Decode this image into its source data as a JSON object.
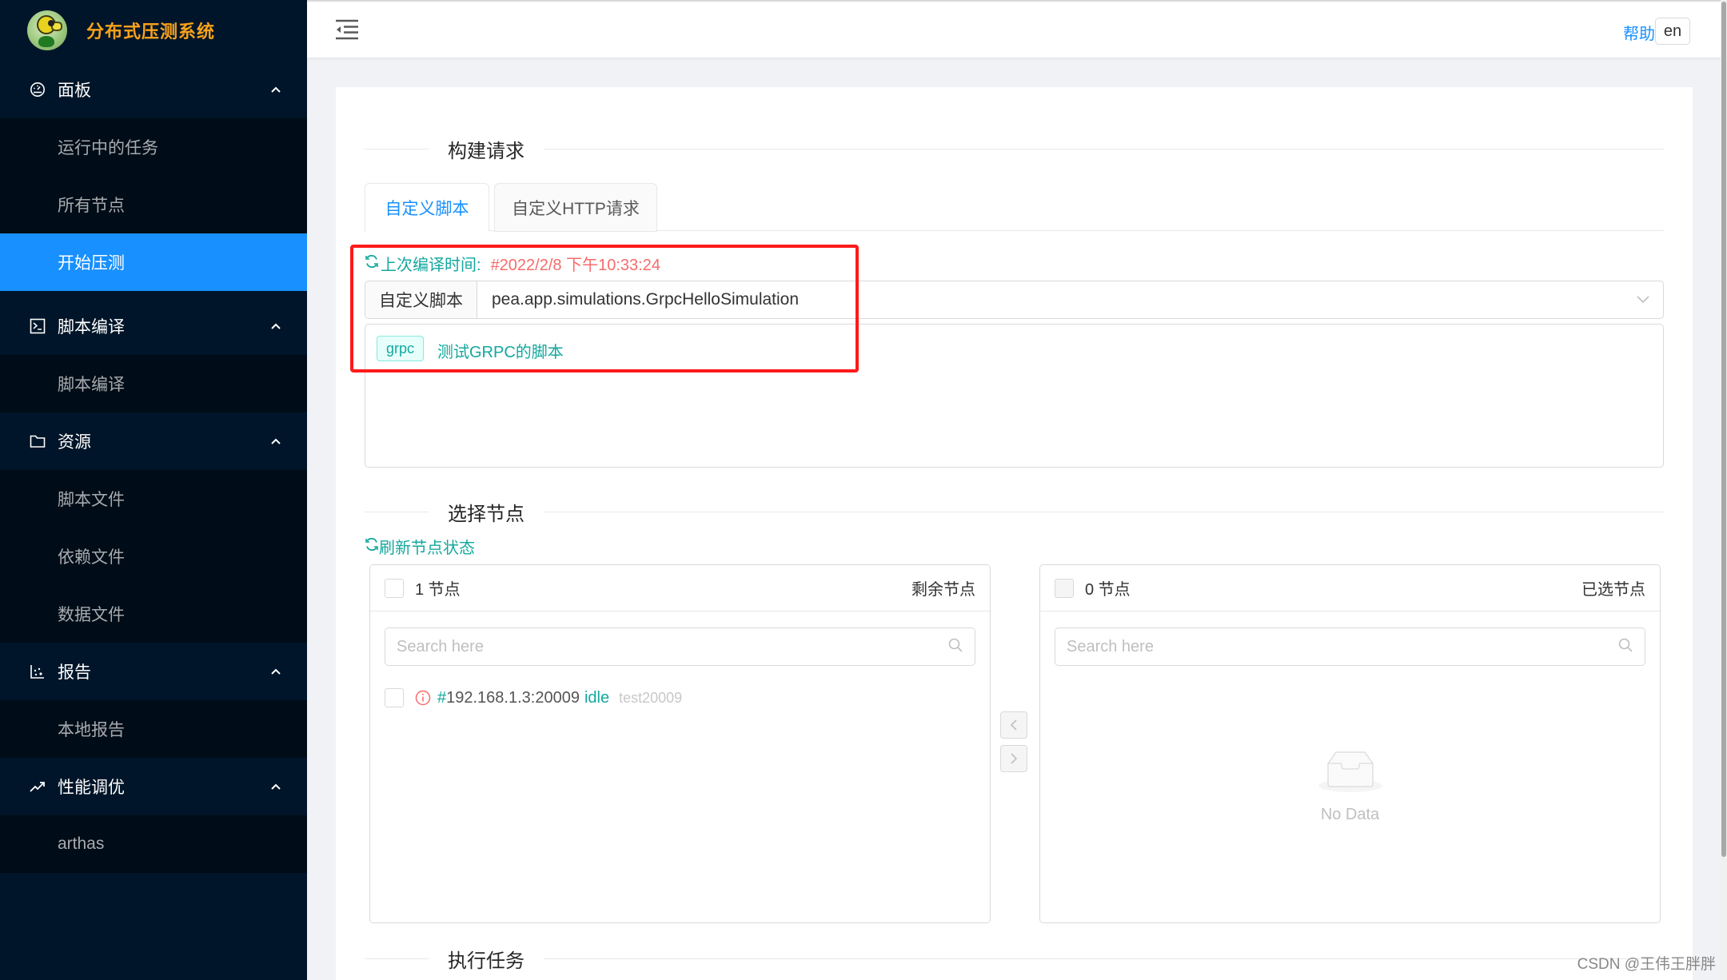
{
  "app": {
    "title": "分布式压测系统"
  },
  "sidebar": {
    "groups": [
      {
        "label": "面板",
        "icon": "dashboard-icon",
        "items": [
          {
            "label": "运行中的任务"
          },
          {
            "label": "所有节点"
          },
          {
            "label": "开始压测",
            "active": true
          }
        ]
      },
      {
        "label": "脚本编译",
        "icon": "terminal-icon",
        "items": [
          {
            "label": "脚本编译"
          }
        ]
      },
      {
        "label": "资源",
        "icon": "folder-icon",
        "items": [
          {
            "label": "脚本文件"
          },
          {
            "label": "依赖文件"
          },
          {
            "label": "数据文件"
          }
        ]
      },
      {
        "label": "报告",
        "icon": "dot-chart-icon",
        "items": [
          {
            "label": "本地报告"
          }
        ]
      },
      {
        "label": "性能调优",
        "icon": "rise-icon",
        "items": [
          {
            "label": "arthas"
          }
        ]
      }
    ]
  },
  "header": {
    "help_label": "帮助",
    "lang_label": "en"
  },
  "main": {
    "section_build": "构建请求",
    "tabs": [
      {
        "label": "自定义脚本",
        "active": true
      },
      {
        "label": "自定义HTTP请求",
        "active": false
      }
    ],
    "compile": {
      "label": "上次编译时间:",
      "time": "#2022/2/8 下午10:33:24"
    },
    "script_select": {
      "addon_label": "自定义脚本",
      "value": "pea.app.simulations.GrpcHelloSimulation"
    },
    "script_desc": {
      "tag": "grpc",
      "text": "测试GRPC的脚本"
    },
    "section_nodes": "选择节点",
    "refresh_label": "刷新节点状态",
    "transfer": {
      "left": {
        "count_label": "1 节点",
        "title": "剩余节点",
        "search_placeholder": "Search here",
        "items": [
          {
            "hash": "#",
            "address": "192.168.1.3:20009",
            "status": "idle",
            "name": "test20009"
          }
        ]
      },
      "right": {
        "count_label": "0 节点",
        "title": "已选节点",
        "search_placeholder": "Search here",
        "empty_text": "No Data"
      }
    },
    "section_exec": "执行任务"
  },
  "colors": {
    "sidebar_bg": "#001529",
    "submenu_bg": "#000c17",
    "primary": "#1890ff",
    "teal": "#13a89e",
    "danger": "#f56c6c",
    "logo_text": "#faa21a",
    "highlight_box": "#ff1a1a"
  },
  "watermark": "CSDN @王伟王胖胖"
}
